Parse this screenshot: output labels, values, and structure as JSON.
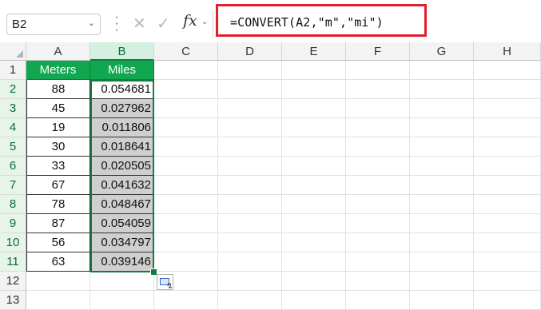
{
  "name_box": {
    "value": "B2"
  },
  "formula_bar": {
    "fx_label": "fx",
    "formula": "=CONVERT(A2,\"m\",\"mi\")"
  },
  "columns": [
    "A",
    "B",
    "C",
    "D",
    "E",
    "F",
    "G",
    "H"
  ],
  "rows": [
    "1",
    "2",
    "3",
    "4",
    "5",
    "6",
    "7",
    "8",
    "9",
    "10",
    "11",
    "12",
    "13"
  ],
  "table": {
    "headers": [
      "Meters",
      "Miles"
    ],
    "rows": [
      [
        "88",
        "0.054681"
      ],
      [
        "45",
        "0.027962"
      ],
      [
        "19",
        "0.011806"
      ],
      [
        "30",
        "0.018641"
      ],
      [
        "33",
        "0.020505"
      ],
      [
        "67",
        "0.041632"
      ],
      [
        "78",
        "0.048467"
      ],
      [
        "87",
        "0.054059"
      ],
      [
        "56",
        "0.034797"
      ],
      [
        "63",
        "0.039146"
      ]
    ]
  },
  "colors": {
    "header_fill": "#11a750",
    "selection": "#107c41",
    "highlight_box": "#e0202b",
    "selected_cells_fill": "#cfcfcf"
  }
}
